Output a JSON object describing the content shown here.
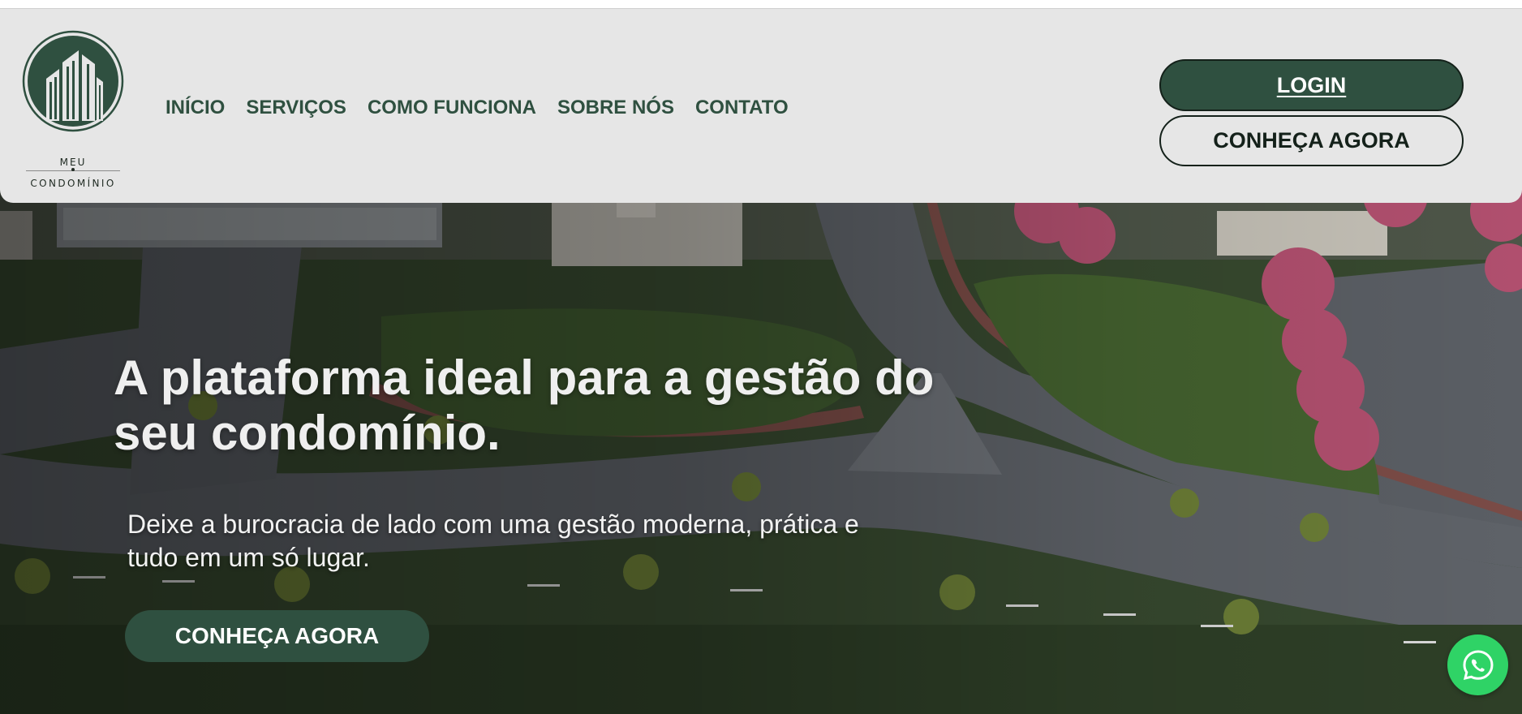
{
  "brand": {
    "name_top": "MEU",
    "name_bottom": "CONDOMÍNIO",
    "logo_icon": "building-emblem-icon",
    "primary_color": "#2f5040",
    "header_bg": "#e6e6e6"
  },
  "nav": {
    "items": [
      {
        "label": "INÍCIO"
      },
      {
        "label": "SERVIÇOS"
      },
      {
        "label": "COMO FUNCIONA"
      },
      {
        "label": "SOBRE NÓS"
      },
      {
        "label": "CONTATO"
      }
    ]
  },
  "header_actions": {
    "login_label": "LOGIN",
    "know_label": "CONHEÇA AGORA"
  },
  "hero": {
    "title": "A plataforma ideal para a gestão do seu condomínio.",
    "subtitle": "Deixe a burocracia de lado com uma gestão moderna, prática e tudo em um só lugar.",
    "cta_label": "CONHEÇA AGORA",
    "background": "aerial-condominium-photo"
  },
  "floating": {
    "whatsapp_icon": "whatsapp-icon",
    "whatsapp_color": "#2fd366"
  }
}
